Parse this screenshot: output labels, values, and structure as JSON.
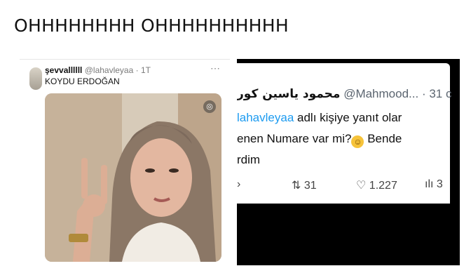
{
  "caption": "OHHHHHHHH OHHHHHHHHHH",
  "left_tweet": {
    "display_name": "şevvallllll",
    "handle": "@lahavleyaa",
    "age": "1T",
    "text": "KOYDU ERDOĞAN",
    "more_icon": "ellipsis-icon",
    "photo_badge_icon": "ai-badge-icon"
  },
  "right_tweet": {
    "author_arabic": "محمود ياسين كور",
    "handle": "@Mahmood...",
    "time": "· 31 c",
    "reply_prefix": "lahavleyaa",
    "reply_suffix": "adlı kişiye yanıt olar",
    "line_a": "enen Numare var mi?",
    "line_a_tail": " Bende",
    "line_b": "rdim",
    "retweets": "31",
    "likes": "1.227",
    "views": "3"
  }
}
